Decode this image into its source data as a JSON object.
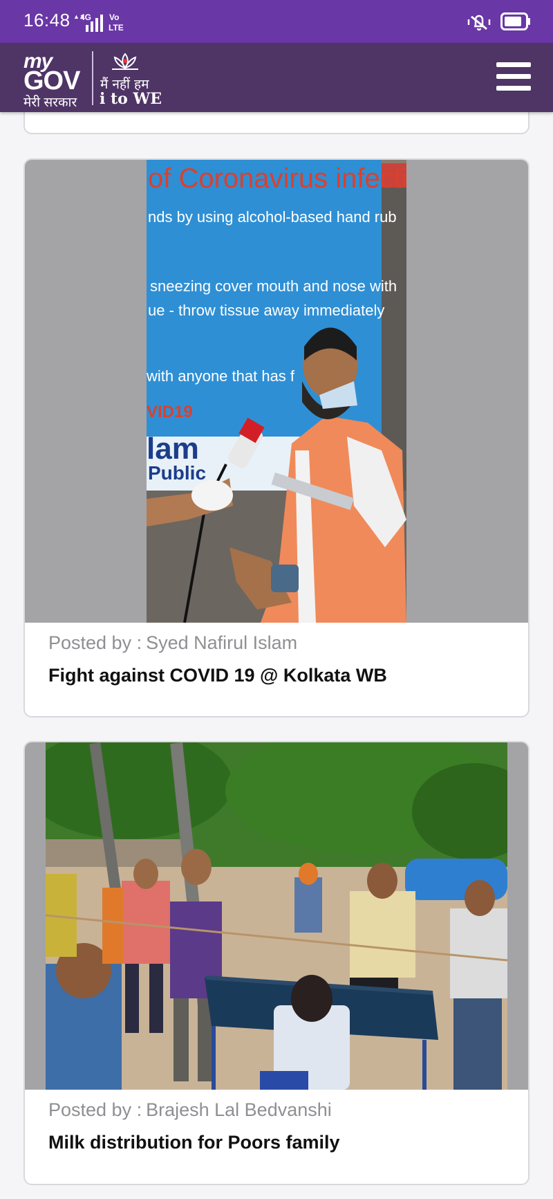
{
  "status_bar": {
    "time": "16:48",
    "network": "4G",
    "volte_line1": "Vo",
    "volte_line2": "LTE",
    "icons": [
      "signal-icon",
      "volte-icon",
      "vibrate-icon",
      "battery-icon"
    ]
  },
  "header": {
    "logo_my": "my",
    "logo_gov": "GOV",
    "logo_hindi": "मेरी सरकार",
    "tagline_hindi": "मैं नहीं हम",
    "tagline_english": "i to WE",
    "menu_icon": "hamburger-menu-icon"
  },
  "posts": [
    {
      "author_label": "Posted by :",
      "author_name": "Syed Nafirul Islam",
      "title": "Fight against COVID 19 @ Kolkata WB",
      "banner_lines": [
        "of Coronavirus infection :",
        "nds by using alcohol-based hand rub",
        "sneezing cover mouth and nose with",
        "ue - throw tissue away immediately",
        "with anyone that has f",
        "VID19",
        "lam",
        "Public"
      ]
    },
    {
      "author_label": "Posted by :",
      "author_name": "Brajesh Lal Bedvanshi",
      "title": "Milk distribution for Poors family"
    }
  ],
  "colors": {
    "status_bar": "#6a37a6",
    "header": "#4f3466",
    "background": "#f5f5f7",
    "card_border": "#d8d8dd",
    "author_text": "#8f8f93"
  }
}
